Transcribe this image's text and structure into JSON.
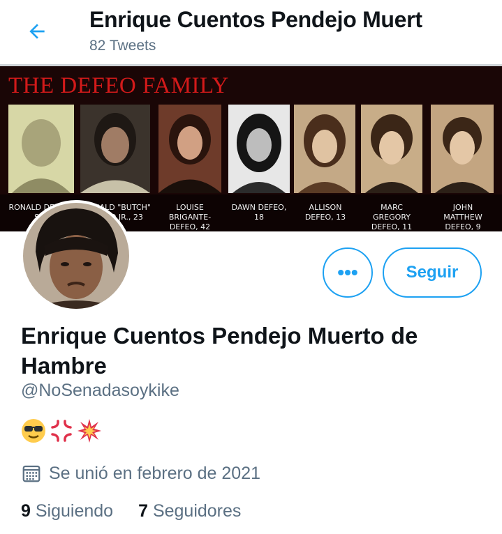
{
  "header": {
    "title": "Enrique Cuentos Pendejo Muerto de Hambre",
    "tweet_count": "82 Tweets"
  },
  "banner": {
    "title": "THE DEFEO FAMILY",
    "captions": [
      "RONALD DEFEO, SR.",
      "RONALD \"BUTCH\" DEFEO JR., 23",
      "LOUISE BRIGANTE-DEFEO, 42",
      "DAWN DEFEO, 18",
      "ALLISON DEFEO, 13",
      "MARC GREGORY DEFEO, 11",
      "JOHN MATTHEW DEFEO, 9"
    ]
  },
  "actions": {
    "more_label": "•••",
    "follow_label": "Seguir"
  },
  "profile": {
    "name": "Enrique Cuentos Pendejo Muerto de Hambre",
    "handle": "@NoSenadasoykike",
    "bio_emojis": [
      "😎",
      "💢",
      "💥"
    ],
    "joined": "Se unió en febrero de 2021",
    "following_count": "9",
    "following_label": "Siguiendo",
    "followers_count": "7",
    "followers_label": "Seguidores"
  },
  "colors": {
    "accent": "#1da1f2",
    "muted": "#5b7083",
    "text": "#0f1419",
    "banner_red": "#d21a1a"
  }
}
